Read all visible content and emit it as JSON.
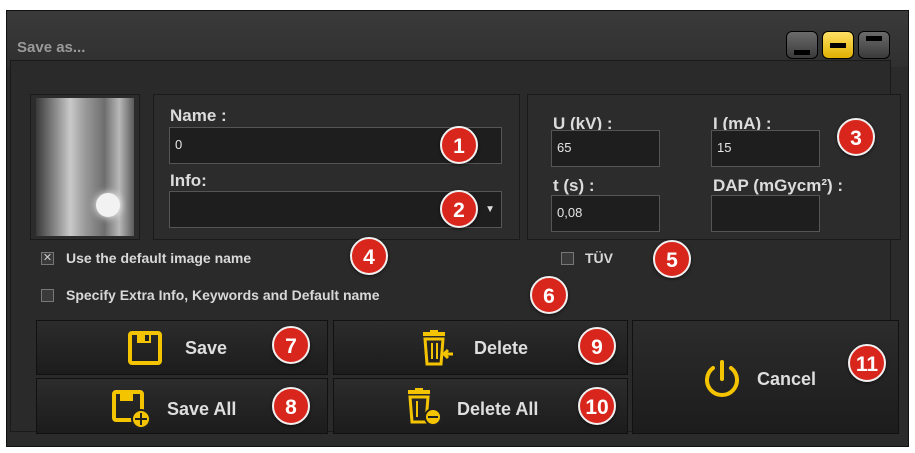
{
  "window": {
    "title": "Save as...",
    "controls": [
      "minimize-icon",
      "restore-icon",
      "maximize-icon"
    ]
  },
  "form": {
    "name_label": "Name :",
    "name_value": "0",
    "info_label": "Info:",
    "info_value": ""
  },
  "params": {
    "u_label": "U (kV) :",
    "u_value": "65",
    "i_label": "I (mA) :",
    "i_value": "15",
    "t_label": "t (s) :",
    "t_value": "0,08",
    "dap_label": "DAP (mGycm²) :",
    "dap_value": ""
  },
  "options": {
    "default_name_label": "Use the default image name",
    "default_name_checked": true,
    "tuv_label": "TÜV",
    "tuv_checked": false,
    "extra_info_label": "Specify Extra Info, Keywords and Default name",
    "extra_info_checked": false
  },
  "buttons": {
    "save": "Save",
    "save_all": "Save All",
    "delete": "Delete",
    "delete_all": "Delete All",
    "cancel": "Cancel"
  },
  "badges": [
    "1",
    "2",
    "3",
    "4",
    "5",
    "6",
    "7",
    "8",
    "9",
    "10",
    "11"
  ],
  "colors": {
    "accent": "#f5c400",
    "badge": "#d9261c",
    "background": "#2b2b2b"
  }
}
